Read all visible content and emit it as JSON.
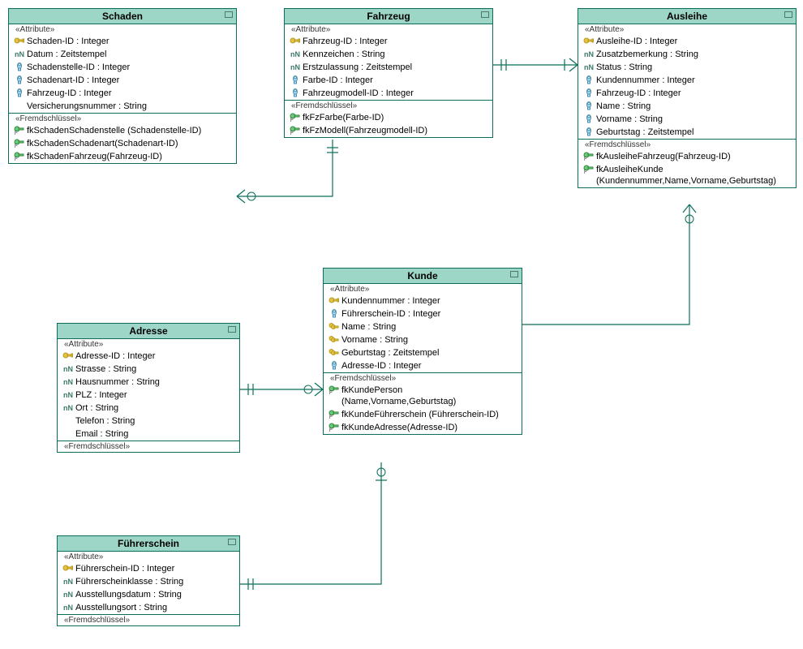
{
  "labels": {
    "attributeStereo": "«Attribute»",
    "fkStereo": "«Fremdschlüssel»"
  },
  "entities": {
    "schaden": {
      "title": "Schaden",
      "attrs": [
        {
          "icon": "pk",
          "text": "Schaden-ID : Integer"
        },
        {
          "icon": "nn",
          "text": "Datum : Zeitstempel"
        },
        {
          "icon": "fk",
          "text": "Schadenstelle-ID : Integer"
        },
        {
          "icon": "fk",
          "text": "Schadenart-ID : Integer"
        },
        {
          "icon": "fk",
          "text": "Fahrzeug-ID : Integer"
        },
        {
          "icon": "none",
          "text": "Versicherungsnummer : String"
        }
      ],
      "fks": [
        {
          "icon": "fkref",
          "text": "fkSchadenSchadenstelle (Schadenstelle-ID)"
        },
        {
          "icon": "fkref",
          "text": "fkSchadenSchadenart(Schadenart-ID)"
        },
        {
          "icon": "fkref",
          "text": "fkSchadenFahrzeug(Fahrzeug-ID)"
        }
      ]
    },
    "fahrzeug": {
      "title": "Fahrzeug",
      "attrs": [
        {
          "icon": "pk",
          "text": "Fahrzeug-ID : Integer"
        },
        {
          "icon": "nn",
          "text": "Kennzeichen : String"
        },
        {
          "icon": "nn",
          "text": "Erstzulassung : Zeitstempel"
        },
        {
          "icon": "fk",
          "text": "Farbe-ID : Integer"
        },
        {
          "icon": "fk",
          "text": "Fahrzeugmodell-ID : Integer"
        }
      ],
      "fks": [
        {
          "icon": "fkref",
          "text": "fkFzFarbe(Farbe-ID)"
        },
        {
          "icon": "fkref",
          "text": "fkFzModell(Fahrzeugmodell-ID)"
        }
      ]
    },
    "ausleihe": {
      "title": "Ausleihe",
      "attrs": [
        {
          "icon": "pk",
          "text": "Ausleihe-ID : Integer"
        },
        {
          "icon": "nn",
          "text": "Zusatzbemerkung : String"
        },
        {
          "icon": "nn",
          "text": "Status : String"
        },
        {
          "icon": "fk",
          "text": "Kundennummer : Integer"
        },
        {
          "icon": "fk",
          "text": "Fahrzeug-ID : Integer"
        },
        {
          "icon": "fk",
          "text": "Name : String"
        },
        {
          "icon": "fk",
          "text": "Vorname : String"
        },
        {
          "icon": "fk",
          "text": "Geburtstag : Zeitstempel"
        }
      ],
      "fks": [
        {
          "icon": "fkref",
          "text": "fkAusleiheFahrzeug(Fahrzeug-ID)"
        },
        {
          "icon": "fkref",
          "text": "fkAusleiheKunde (Kundennummer,Name,Vorname,Geburtstag)"
        }
      ]
    },
    "kunde": {
      "title": "Kunde",
      "attrs": [
        {
          "icon": "pk",
          "text": "Kundennummer : Integer"
        },
        {
          "icon": "fk",
          "text": "Führerschein-ID : Integer"
        },
        {
          "icon": "pkalt",
          "text": "Name : String"
        },
        {
          "icon": "pkalt",
          "text": "Vorname : String"
        },
        {
          "icon": "pkalt",
          "text": "Geburtstag : Zeitstempel"
        },
        {
          "icon": "fk",
          "text": "Adresse-ID : Integer"
        }
      ],
      "fks": [
        {
          "icon": "fkref",
          "text": "fkKundePerson (Name,Vorname,Geburtstag)"
        },
        {
          "icon": "fkref",
          "text": "fkKundeFührerschein (Führerschein-ID)"
        },
        {
          "icon": "fkref",
          "text": "fkKundeAdresse(Adresse-ID)"
        }
      ]
    },
    "adresse": {
      "title": "Adresse",
      "attrs": [
        {
          "icon": "pk",
          "text": "Adresse-ID : Integer"
        },
        {
          "icon": "nn",
          "text": "Strasse : String"
        },
        {
          "icon": "nn",
          "text": "Hausnummer : String"
        },
        {
          "icon": "nn",
          "text": "PLZ : Integer"
        },
        {
          "icon": "nn",
          "text": "Ort : String"
        },
        {
          "icon": "none",
          "text": "Telefon : String"
        },
        {
          "icon": "none",
          "text": "Email : String"
        }
      ],
      "fks": []
    },
    "fuehrerschein": {
      "title": "Führerschein",
      "attrs": [
        {
          "icon": "pk",
          "text": "Führerschein-ID : Integer"
        },
        {
          "icon": "nn",
          "text": "Führerscheinklasse : String"
        },
        {
          "icon": "nn",
          "text": "Ausstellungsdatum : String"
        },
        {
          "icon": "nn",
          "text": "Ausstellungsort : String"
        }
      ],
      "fks": []
    }
  },
  "chart_data": {
    "type": "erd",
    "entities": [
      "Schaden",
      "Fahrzeug",
      "Ausleihe",
      "Kunde",
      "Adresse",
      "Führerschein"
    ],
    "relationships": [
      {
        "from": "Schaden",
        "to": "Fahrzeug",
        "from_end": "many-optional",
        "to_end": "one"
      },
      {
        "from": "Ausleihe",
        "to": "Fahrzeug",
        "from_end": "many-mandatory",
        "to_end": "one"
      },
      {
        "from": "Ausleihe",
        "to": "Kunde",
        "from_end": "many-optional",
        "to_end": "one"
      },
      {
        "from": "Kunde",
        "to": "Adresse",
        "from_end": "many-optional",
        "to_end": "one"
      },
      {
        "from": "Kunde",
        "to": "Führerschein",
        "from_end": "one-optional",
        "to_end": "one"
      }
    ]
  }
}
